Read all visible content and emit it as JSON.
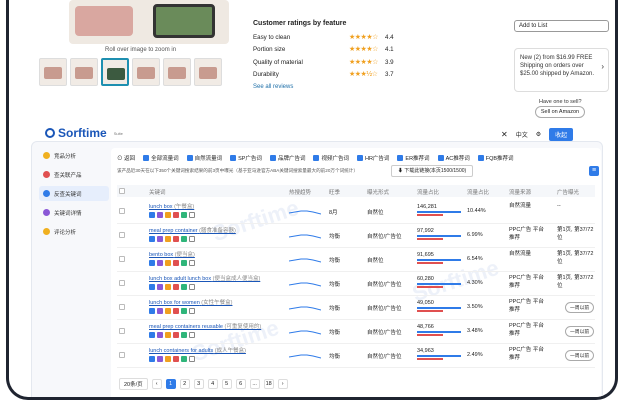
{
  "product": {
    "rollover": "Roll over image to zoom in",
    "ratings_title": "Customer ratings by feature",
    "ratings": [
      {
        "feature": "Easy to clean",
        "score": "4.4"
      },
      {
        "feature": "Portion size",
        "score": "4.1"
      },
      {
        "feature": "Quality of material",
        "score": "3.9"
      },
      {
        "feature": "Durability",
        "score": "3.7"
      }
    ],
    "see_all": "See all reviews",
    "add_to_list": "Add to List",
    "new_offer": "New (2) from $16.99 FREE Shipping on orders over $25.00 shipped by Amazon.",
    "sell_question": "Have one to sell?",
    "sell_button": "Sell on Amazon"
  },
  "sorftime": {
    "logo": "Sorftime",
    "logo_sub": "Suite",
    "lang": "中文",
    "collapse": "收起",
    "sidebar": [
      "竞品分析",
      "查关联产品",
      "反查关键词",
      "关键词详情",
      "评论分析"
    ],
    "sidebar_active": 2,
    "back": "返回",
    "filters": [
      {
        "label": "全部流量词",
        "checked": true
      },
      {
        "label": "自然流量词",
        "checked": true
      },
      {
        "label": "SP广告词",
        "checked": true
      },
      {
        "label": "品牌广告词",
        "checked": true
      },
      {
        "label": "视频广告词",
        "checked": true
      },
      {
        "label": "HR广告词",
        "checked": true
      },
      {
        "label": "ER推荐词",
        "checked": true
      },
      {
        "label": "AC推荐词",
        "checked": true
      },
      {
        "label": "FQB推荐词",
        "checked": true
      }
    ],
    "note": "该产品近30天在以下350个关键词搜索结果的前3页中曝光（基于亚马逊官方ABA关键词搜索量最大的前20万个词统计）",
    "download": "下载此链接(本页1500/1500)",
    "columns": [
      "关键词",
      "热搜趋势",
      "旺季",
      "曝光形式",
      "流量占比",
      "流量占比",
      "流量来源",
      "广告曝光"
    ],
    "rows": [
      {
        "kw": "lunch box",
        "cn": "(午餐盒)",
        "season": "8月",
        "disp": "自然位",
        "sv": "146,281",
        "pct": "10.44%",
        "src": "自然流量",
        "gg": "--"
      },
      {
        "kw": "meal prep container",
        "cn": "(膳食准备容器)",
        "season": "均衡",
        "disp": "自然位/广告位",
        "sv": "97,992",
        "pct": "6.99%",
        "src": "PPC广告 平台推荐",
        "gg": "第1页, 第37/72位"
      },
      {
        "kw": "bento box",
        "cn": "(便当盒)",
        "season": "均衡",
        "disp": "自然位",
        "sv": "91,695",
        "pct": "6.54%",
        "src": "自然流量",
        "gg": "第1页, 第37/72位"
      },
      {
        "kw": "lunch box adult lunch box",
        "cn": "(便当盒成人便当盒)",
        "season": "均衡",
        "disp": "自然位/广告位",
        "sv": "60,280",
        "pct": "4.30%",
        "src": "PPC广告 平台推荐",
        "gg": "第1页, 第37/72位"
      },
      {
        "kw": "lunch box for women",
        "cn": "(女性午餐盒)",
        "season": "均衡",
        "disp": "自然位/广告位",
        "sv": "49,050",
        "pct": "3.50%",
        "src": "PPC广告 平台推荐",
        "gg": "一周以前"
      },
      {
        "kw": "meal prep containers reusable",
        "cn": "(可重复使用的)",
        "season": "均衡",
        "disp": "自然位/广告位",
        "sv": "48,766",
        "pct": "3.48%",
        "src": "PPC广告 平台推荐",
        "gg": "一周以前"
      },
      {
        "kw": "lunch containers for adults",
        "cn": "(成人午餐盒)",
        "season": "均衡",
        "disp": "自然位/广告位",
        "sv": "34,963",
        "pct": "2.49%",
        "src": "PPC广告 平台推荐",
        "gg": "一周以前"
      }
    ],
    "pager": {
      "size": "20条/页",
      "pages": [
        "1",
        "2",
        "3",
        "4",
        "5",
        "6",
        "...",
        "18"
      ],
      "current": "1"
    }
  }
}
